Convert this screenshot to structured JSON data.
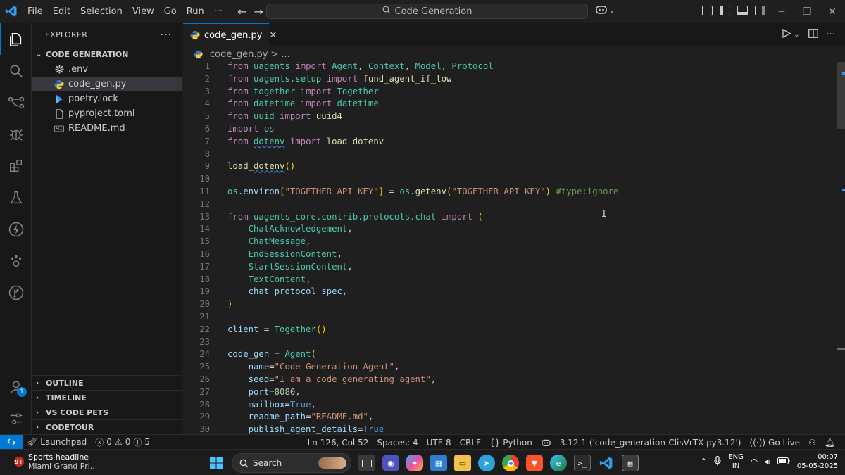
{
  "titlebar": {
    "menu": [
      "File",
      "Edit",
      "Selection",
      "View",
      "Go",
      "Run",
      "···"
    ],
    "command_center": "Code Generation"
  },
  "explorer": {
    "title": "EXPLORER",
    "root": "CODE GENERATION",
    "files": [
      {
        "name": ".env",
        "icon": "gear-icon"
      },
      {
        "name": "code_gen.py",
        "icon": "python-icon"
      },
      {
        "name": "poetry.lock",
        "icon": "poetry-icon"
      },
      {
        "name": "pyproject.toml",
        "icon": "file-icon"
      },
      {
        "name": "README.md",
        "icon": "markdown-icon"
      }
    ],
    "sections": [
      "OUTLINE",
      "TIMELINE",
      "VS CODE PETS",
      "CODETOUR"
    ],
    "accounts_badge": "1"
  },
  "editor": {
    "tab": "code_gen.py",
    "breadcrumb": [
      "code_gen.py",
      ">",
      "..."
    ],
    "line_numbers": [
      "1",
      "2",
      "3",
      "4",
      "5",
      "6",
      "7",
      "8",
      "9",
      "10",
      "11",
      "12",
      "13",
      "14",
      "15",
      "16",
      "17",
      "18",
      "19",
      "20",
      "21",
      "22",
      "23",
      "24",
      "25",
      "26",
      "27",
      "28",
      "29",
      "30"
    ]
  },
  "statusbar": {
    "launchpad": "Launchpad",
    "errors": "0",
    "warnings": "0",
    "info": "5",
    "position": "Ln 126, Col 52",
    "spaces": "Spaces: 4",
    "encoding": "UTF-8",
    "eol": "CRLF",
    "language": "Python",
    "interpreter": "3.12.1 ('code_generation-ClisVrTX-py3.12')",
    "golive": "Go Live"
  },
  "taskbar": {
    "news_title": "Sports headline",
    "news_sub": "Miami Grand Pri...",
    "search": "Search",
    "lang_top": "ENG",
    "lang_bottom": "IN",
    "time": "00:07",
    "date": "05-05-2025"
  }
}
